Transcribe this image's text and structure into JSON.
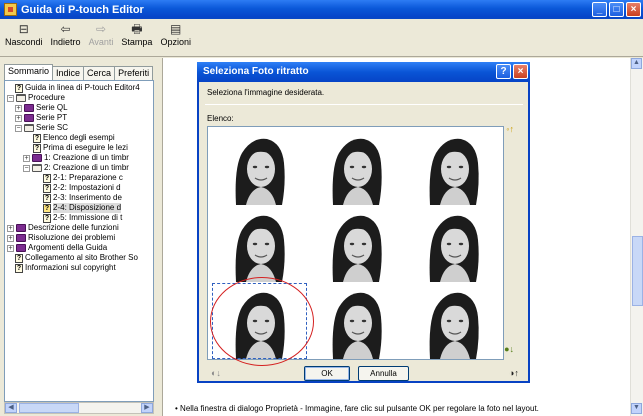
{
  "window": {
    "title": "Guida di P-touch Editor"
  },
  "toolbar": {
    "buttons": [
      {
        "label": "Nascondi",
        "icon": "hide-icon"
      },
      {
        "label": "Indietro",
        "icon": "back-arrow-icon"
      },
      {
        "label": "Avanti",
        "icon": "forward-arrow-icon"
      },
      {
        "label": "Stampa",
        "icon": "print-icon"
      },
      {
        "label": "Opzioni",
        "icon": "options-icon"
      }
    ]
  },
  "nav": {
    "tabs": [
      "Sommario",
      "Indice",
      "Cerca",
      "Preferiti"
    ],
    "tree": [
      {
        "label": "Guida in linea di P-touch Editor4",
        "type": "topic"
      },
      {
        "label": "Procedure",
        "type": "book-open"
      },
      {
        "label": "Serie QL",
        "type": "book"
      },
      {
        "label": "Serie PT",
        "type": "book"
      },
      {
        "label": "Serie SC",
        "type": "book-open"
      },
      {
        "label": "Elenco degli esempi",
        "type": "topic"
      },
      {
        "label": "Prima di eseguire le lezi",
        "type": "topic"
      },
      {
        "label": "1: Creazione di un timbr",
        "type": "book"
      },
      {
        "label": "2: Creazione di un timbr",
        "type": "book-open"
      },
      {
        "label": "2-1: Preparazione c",
        "type": "topic"
      },
      {
        "label": "2-2: Impostazioni d",
        "type": "topic"
      },
      {
        "label": "2-3: Inserimento de",
        "type": "topic"
      },
      {
        "label": "2-4: Disposizione d",
        "type": "topic-selected"
      },
      {
        "label": "2-5: Immissione di t",
        "type": "topic"
      },
      {
        "label": "Descrizione delle funzioni",
        "type": "book"
      },
      {
        "label": "Risoluzione dei problemi",
        "type": "book"
      },
      {
        "label": "Argomenti della Guida",
        "type": "book"
      },
      {
        "label": "Collegamento al sito Brother So",
        "type": "topic"
      },
      {
        "label": "Informazioni sul copyright",
        "type": "topic"
      }
    ]
  },
  "dialog": {
    "title": "Seleziona Foto ritratto",
    "instruction": "Seleziona l'immagine desiderata.",
    "list_label": "Elenco:",
    "ok_label": "OK",
    "cancel_label": "Annulla",
    "photo_count": 9,
    "selected_index": 6
  },
  "content": {
    "bullet_text": "Nella finestra di dialogo Proprietà - Immagine, fare clic sul pulsante OK per regolare la foto nel layout."
  },
  "colors": {
    "titlebar": "#0a57d8",
    "annotation_circle": "#d42020"
  }
}
